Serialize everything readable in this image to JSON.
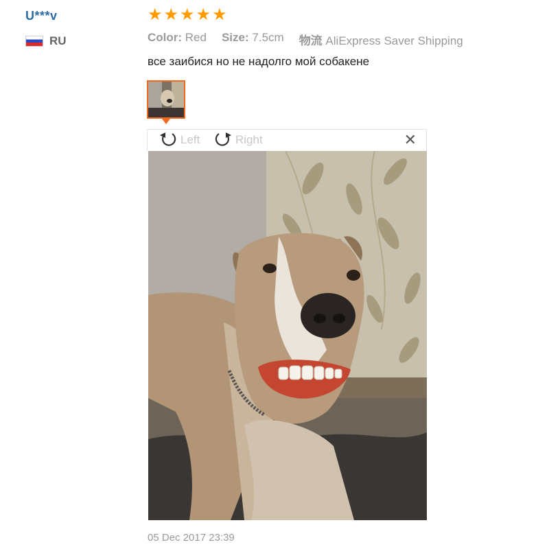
{
  "reviewer": {
    "name": "U***v",
    "country_code": "RU",
    "flag_icon": "russia-flag-icon"
  },
  "rating": {
    "stars": 5,
    "max": 5,
    "color": "#ff9a00"
  },
  "attributes": {
    "color_label": "Color:",
    "color_value": "Red",
    "size_label": "Size:",
    "size_value": "7.5cm",
    "shipping_label": "物流",
    "shipping_value": "AliExpress Saver Shipping"
  },
  "review_text": "все заибися но не надолго мой собакене",
  "viewer": {
    "rotate_left_label": "Left",
    "rotate_right_label": "Right",
    "close_icon": "close-icon",
    "accent": "#f46a1d"
  },
  "date": "05 Dec 2017 23:39"
}
